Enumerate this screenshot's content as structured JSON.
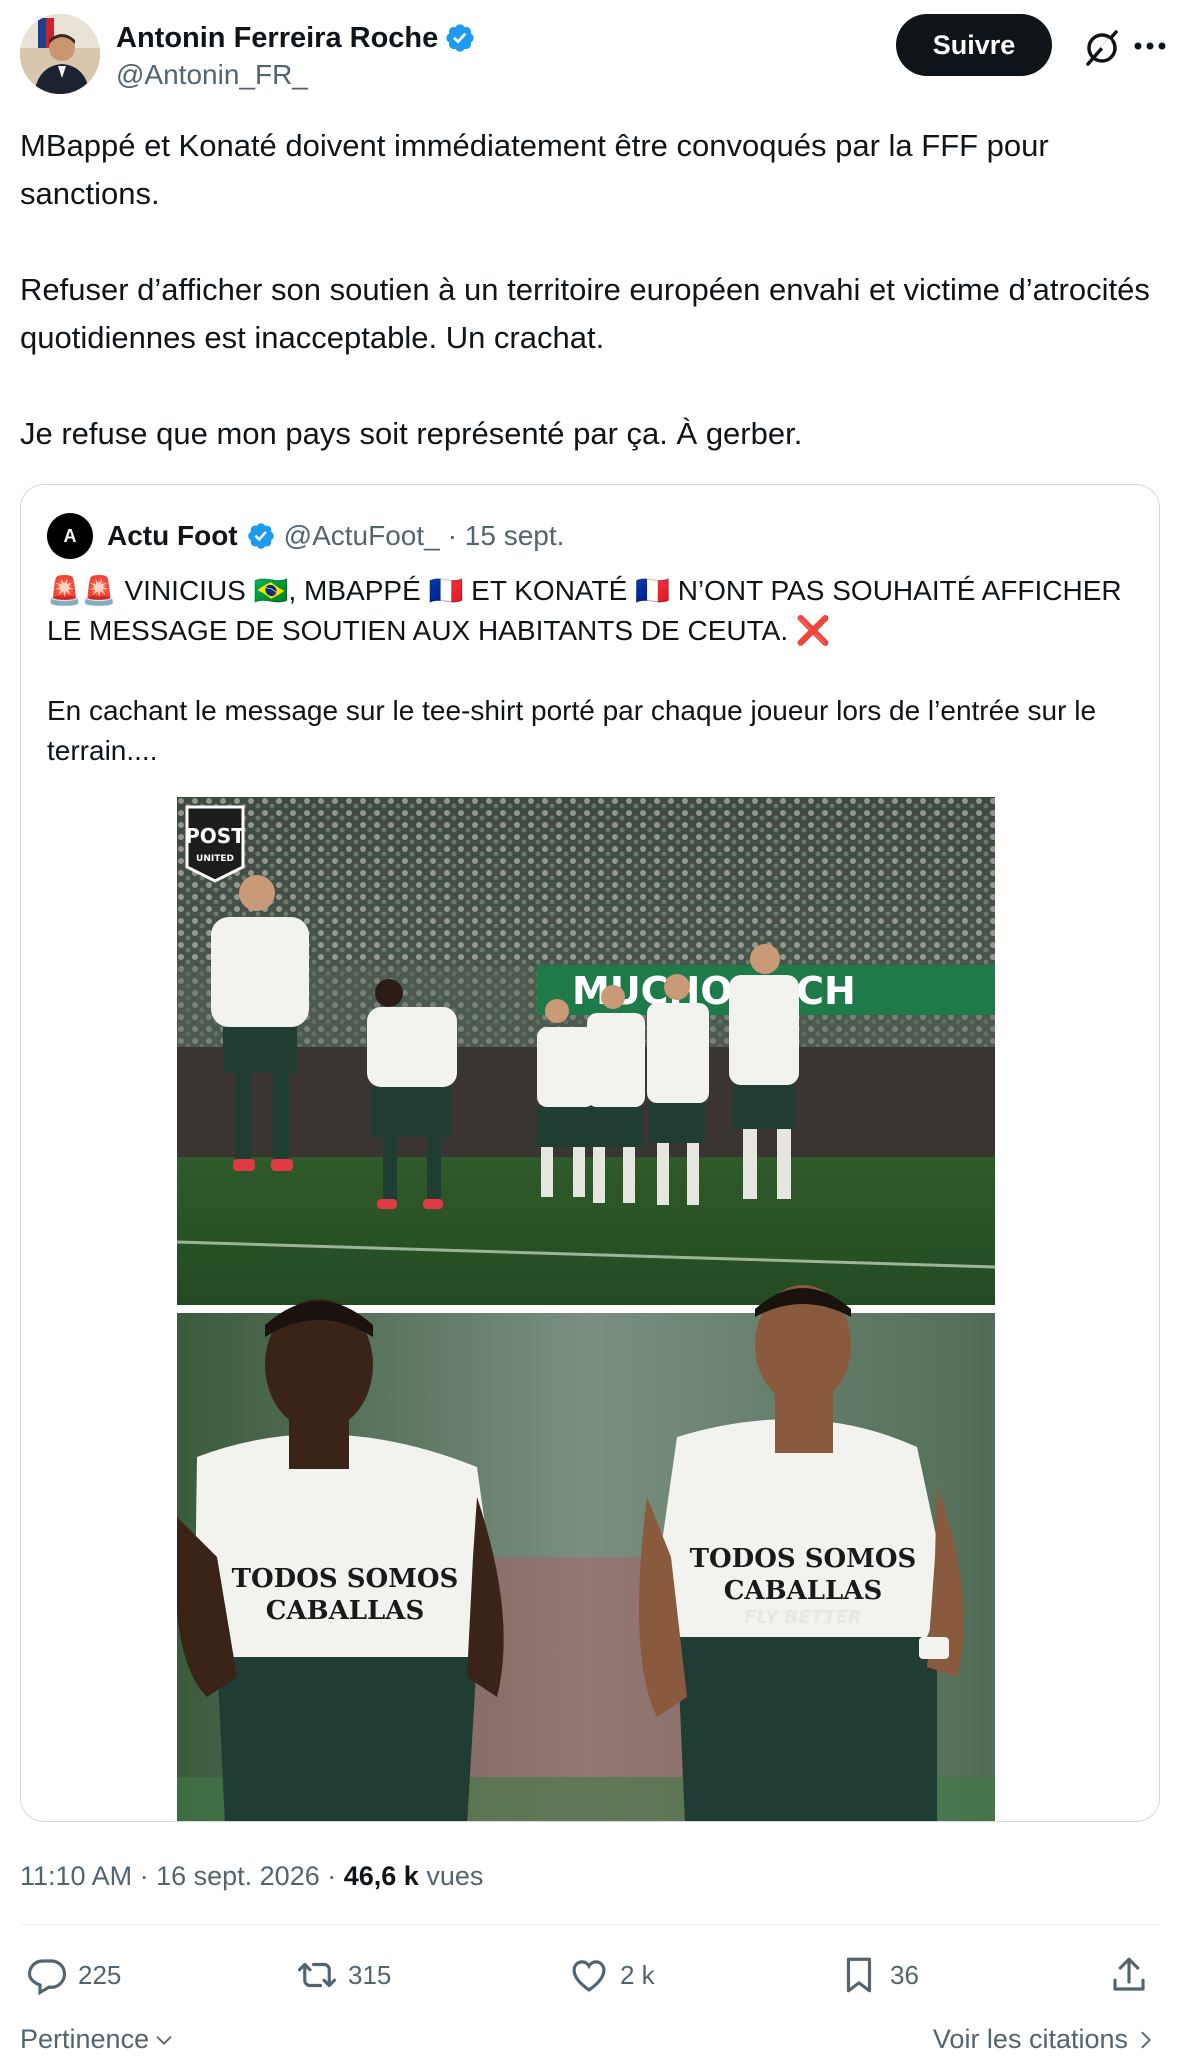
{
  "author": {
    "name": "Antonin Ferreira Roche",
    "handle": "@Antonin_FR_",
    "follow_label": "Suivre"
  },
  "tweet": {
    "text": "MBappé et Konaté doivent immédiatement être convoqués par la FFF pour sanctions.\n\nRefuser d’afficher son soutien à un territoire européen envahi et victime d’atrocités quotidiennes est inacceptable. Un crachat.\n\nJe refuse que mon pays soit représenté par ça. À gerber."
  },
  "quote": {
    "name": "Actu Foot",
    "handle": "@ActuFoot_",
    "date": "· 15 sept.",
    "avatar_text": "A",
    "text": "🚨🚨 VINICIUS 🇧🇷, MBAPPÉ 🇫🇷 ET KONATÉ 🇫🇷 N’ONT PAS SOUHAITÉ AFFICHER LE MESSAGE DE SOUTIEN AUX HABITANTS DE CEUTA. ❌\n\nEn cachant le message sur le tee-shirt porté par chaque joueur lors de l’entrée sur le terrain....",
    "media": {
      "logo_top": "POST",
      "logo_bottom": "UNITED",
      "banner": "MUCHO ELCH",
      "shirt_text_1": "TODOS SOMOS",
      "shirt_text_2": "CABALLAS",
      "shirt_text_3": "FLY BETTER"
    }
  },
  "meta": {
    "time": "11:10 AM",
    "date": "16 sept. 2026",
    "views_count": "46,6 k",
    "views_label": "vues"
  },
  "actions": {
    "replies": "225",
    "retweets": "315",
    "likes": "2 k",
    "bookmarks": "36"
  },
  "footer": {
    "sort_label": "Pertinence",
    "quotes_label": "Voir les citations"
  },
  "colors": {
    "verified": "#1d9bf0",
    "text": "#0f1419",
    "secondary": "#536471",
    "border": "#cfd9de"
  }
}
